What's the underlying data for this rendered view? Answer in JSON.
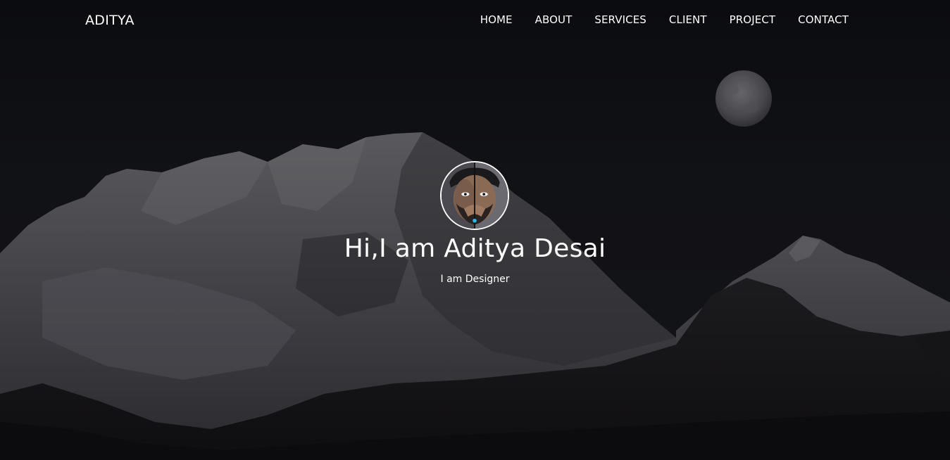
{
  "nav": {
    "brand": "ADITYA",
    "links": [
      {
        "label": "HOME"
      },
      {
        "label": "ABOUT"
      },
      {
        "label": "SERVICES"
      },
      {
        "label": "CLIENT"
      },
      {
        "label": "PROJECT"
      },
      {
        "label": "CONTACT"
      }
    ]
  },
  "hero": {
    "title": "Hi,I am Aditya Desai",
    "subtitle": "I am Designer",
    "background_image": "night-mountain-moon",
    "profile_image": "avatar-photo"
  },
  "colors": {
    "background": "#0f1014",
    "text": "#ffffff"
  }
}
